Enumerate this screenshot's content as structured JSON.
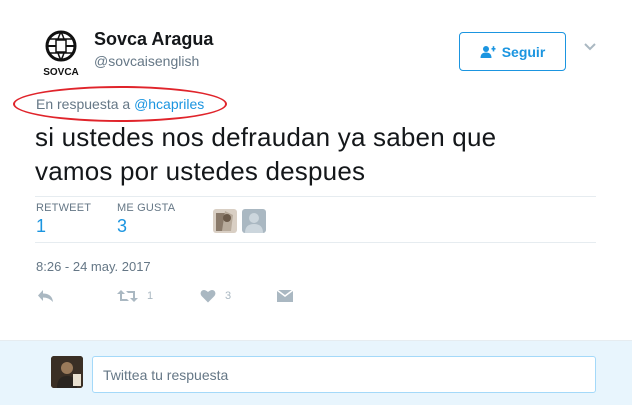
{
  "user": {
    "display_name": "Sovca Aragua",
    "handle": "@sovcaisenglish",
    "avatar_text": "SOVCA"
  },
  "follow_button": {
    "label": "Seguir"
  },
  "reply_context": {
    "prefix": "En respuesta a",
    "mention": "@hcapriles"
  },
  "tweet": {
    "text_line1": "si ustedes nos defraudan ya saben que",
    "text_line2": "vamos por ustedes despues"
  },
  "stats": {
    "retweet_label": "RETWEET",
    "retweet_count": "1",
    "likes_label": "ME GUSTA",
    "likes_count": "3"
  },
  "timestamp": "8:26 - 24 may. 2017",
  "actions": {
    "retweet_count": "1",
    "like_count": "3"
  },
  "reply_box": {
    "placeholder": "Twittea tu respuesta"
  },
  "colors": {
    "accent": "#1b95e0",
    "muted": "#657786",
    "highlight_circle": "#e0242b",
    "reply_bar_bg": "#e8f5fd"
  }
}
